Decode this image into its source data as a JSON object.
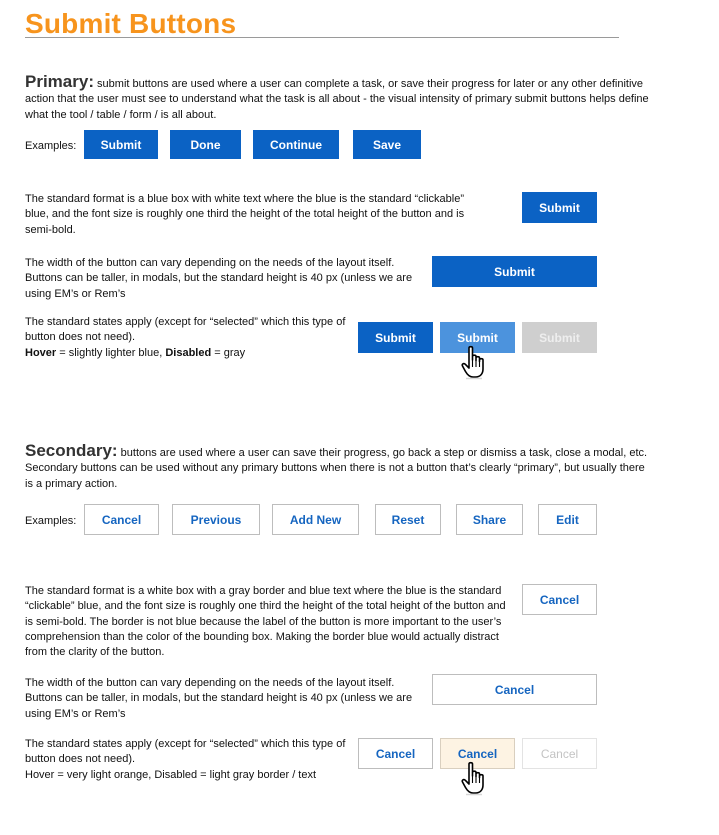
{
  "page": {
    "title": "Submit Buttons"
  },
  "primary": {
    "heading": "Primary:",
    "intro": " submit buttons are used where a user can complete a task, or save their progress for later or any other definitive action that the user must see to understand what the task is all about - the visual intensity of primary submit buttons helps define what the tool / table / form / is all about.",
    "examples_label": "Examples:",
    "examples": [
      "Submit",
      "Done",
      "Continue",
      "Save"
    ],
    "format_text": "The standard format is a blue box with white text where the blue is the standard “clickable” blue, and the font size is roughly one third the height of the total height of the button and is semi-bold.",
    "format_button": "Submit",
    "width_text": "The width of the button can vary depending on the needs of the layout itself.  Buttons can be taller, in modals, but the standard height is 40 px (unless we are using EM’s or Rem’s",
    "width_button": "Submit",
    "states_text_1": "The standard states apply (except for “selected” which this type of button does not need).",
    "states_hover_label": "Hover",
    "states_hover_desc": " = slightly lighter blue,  ",
    "states_disabled_label": "Disabled",
    "states_disabled_desc": " = gray",
    "state_buttons": {
      "normal": "Submit",
      "hover": "Submit",
      "disabled": "Submit"
    },
    "colors": {
      "normal": "#0b62c4",
      "hover": "#4c93dd",
      "disabled": "#cfcfcf"
    }
  },
  "secondary": {
    "heading": "Secondary:",
    "intro": "  buttons are used where a user can save their progress, go back a step or dismiss a task, close a modal, etc.  Secondary buttons can be used without any primary buttons when there is not a button that’s clearly “primary”, but usually there is a primary action.",
    "examples_label": "Examples:",
    "examples": [
      "Cancel",
      "Previous",
      "Add New",
      "Reset",
      "Share",
      "Edit"
    ],
    "format_text": "The standard format is a white box with a gray border and blue text where the blue is the standard “clickable” blue, and the font size is roughly one third the height of the total height of the button and is semi-bold.  The border is not blue because the label of the button is more important to the user’s comprehension than the color of the bounding box. Making the border blue would actually distract from the clarity of the button.",
    "format_button": "Cancel",
    "width_text": "The width of the button can vary depending on the needs of the layout itself.  Buttons can be taller, in modals, but the standard height is 40 px (unless we are using EM’s or Rem’s",
    "width_button": "Cancel",
    "states_text": "The standard states apply (except for “selected” which this type of button does not need).",
    "states_text_2": "Hover = very light orange,  Disabled = light gray border / text",
    "state_buttons": {
      "normal": "Cancel",
      "hover": "Cancel",
      "disabled": "Cancel"
    },
    "colors": {
      "text": "#1565c0",
      "hover_bg": "#fdf3e3",
      "border": "#bdbdbd"
    }
  },
  "accent_color": "#f7941d",
  "icons": [
    "hand-pointer-icon",
    "hand-pointer-icon"
  ]
}
